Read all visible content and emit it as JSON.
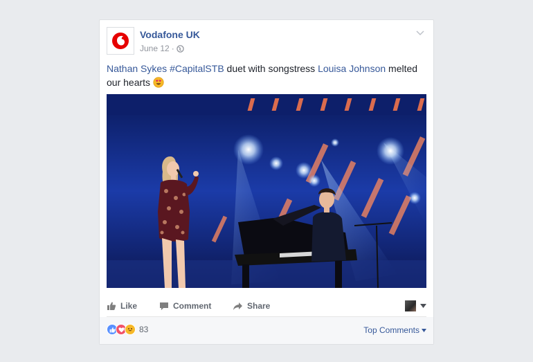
{
  "post": {
    "page_name": "Vodafone UK",
    "date": "June 12",
    "date_separator": "·",
    "text": {
      "mention_1": "Nathan Sykes",
      "hashtag": "#CapitalSTB",
      "middle": " duet with songstress ",
      "mention_2": "Louisa Johnson",
      "end": " melted our hearts"
    },
    "photo_alt": "Singer performing at microphone next to pianist on stage"
  },
  "actions": {
    "like": "Like",
    "comment": "Comment",
    "share": "Share"
  },
  "footer": {
    "reaction_count": "83",
    "sort_label": "Top Comments"
  },
  "colors": {
    "link": "#365899",
    "vodafone_red": "#e60000",
    "action_text": "#616770",
    "like_blue": "#5890ff",
    "love_red": "#f25268",
    "wow_yellow": "#f7b928"
  }
}
